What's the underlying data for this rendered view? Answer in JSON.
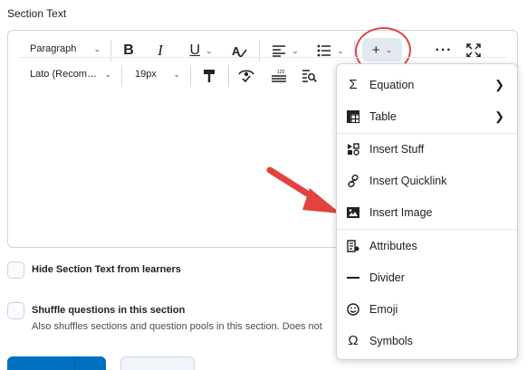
{
  "section": {
    "label": "Section Text"
  },
  "toolbar": {
    "block_format": "Paragraph",
    "font_family": "Lato (Recom…",
    "font_size": "19px"
  },
  "options": {
    "hide_text_label": "Hide Section Text from learners",
    "shuffle_label": "Shuffle questions in this section",
    "shuffle_desc": "Also shuffles sections and question pools in this section. Does not"
  },
  "insert_menu": {
    "items": [
      {
        "label": "Equation",
        "icon": "sigma-icon",
        "submenu": true
      },
      {
        "label": "Table",
        "icon": "table-grid-icon",
        "submenu": true
      },
      {
        "label": "Insert Stuff",
        "icon": "insert-stuff-icon"
      },
      {
        "label": "Insert Quicklink",
        "icon": "link-icon"
      },
      {
        "label": "Insert Image",
        "icon": "image-icon"
      },
      {
        "label": "Attributes",
        "icon": "attributes-icon"
      },
      {
        "label": "Divider",
        "icon": "divider-icon"
      },
      {
        "label": "Emoji",
        "icon": "emoji-icon"
      },
      {
        "label": "Symbols",
        "icon": "omega-icon"
      }
    ]
  },
  "colors": {
    "annotation_red": "#e2433f",
    "primary_blue": "#006fbf"
  }
}
